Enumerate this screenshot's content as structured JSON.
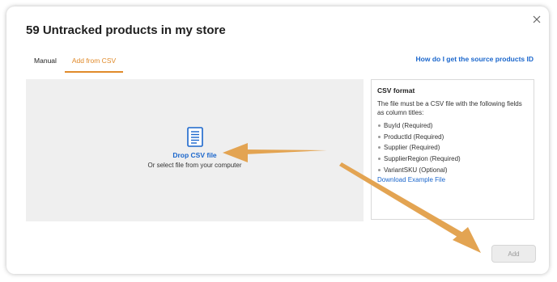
{
  "modal": {
    "title": "59 Untracked products in my store",
    "close_icon": "close-icon"
  },
  "tabs": [
    {
      "label": "Manual",
      "active": false
    },
    {
      "label": "Add from CSV",
      "active": true
    }
  ],
  "help_link": "How do I get the source products ID",
  "dropzone": {
    "icon": "document-icon",
    "label": "Drop CSV file",
    "sublabel": "Or select file from your computer"
  },
  "csv_format": {
    "title": "CSV format",
    "description": "The file must be a CSV file with the following fields as column titles:",
    "fields": [
      "BuyId (Required)",
      "ProductId (Required)",
      "Supplier (Required)",
      "SupplierRegion (Required)",
      "VariantSKU (Optional)"
    ],
    "download_link": "Download Example File"
  },
  "actions": {
    "add_label": "Add",
    "add_disabled": true
  },
  "colors": {
    "accent": "#e08a2a",
    "link": "#1a66cc",
    "annotation_arrow": "#e3a452"
  }
}
